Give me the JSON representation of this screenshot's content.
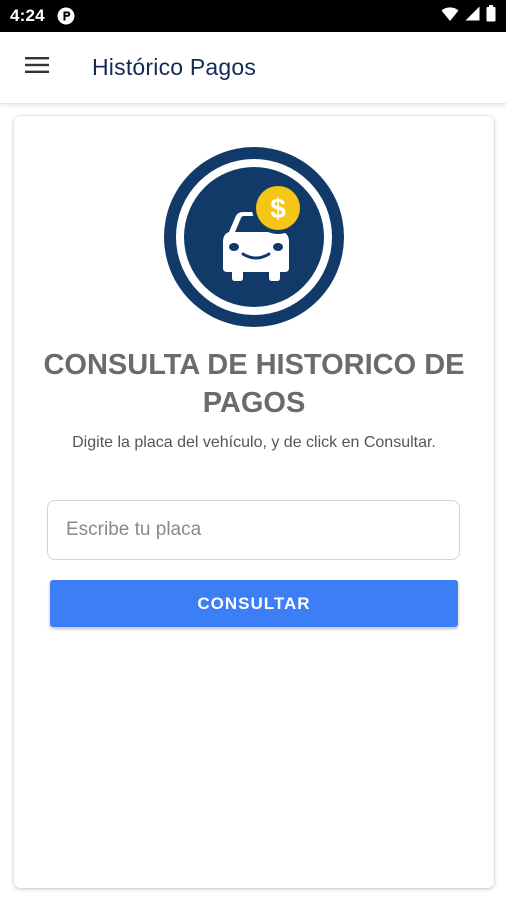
{
  "status_bar": {
    "time": "4:24",
    "icons": [
      "app-notification-icon",
      "wifi-icon",
      "signal-icon",
      "battery-icon"
    ]
  },
  "app_bar": {
    "title": "Histórico Pagos",
    "menu_icon": "hamburger-menu-icon",
    "title_color": "#14295a"
  },
  "main": {
    "logo_icon": "car-payment-logo-icon",
    "heading": "CONSULTA DE HISTORICO DE PAGOS",
    "instructions": "Digite la placa del vehículo, y de click en Consultar.",
    "plate_input": {
      "value": "",
      "placeholder": "Escribe tu placa"
    },
    "consult_button_label": "CONSULTAR",
    "accent_color": "#3c7ef6",
    "logo_colors": {
      "navy": "#123a69",
      "coin": "#f5c518"
    }
  }
}
